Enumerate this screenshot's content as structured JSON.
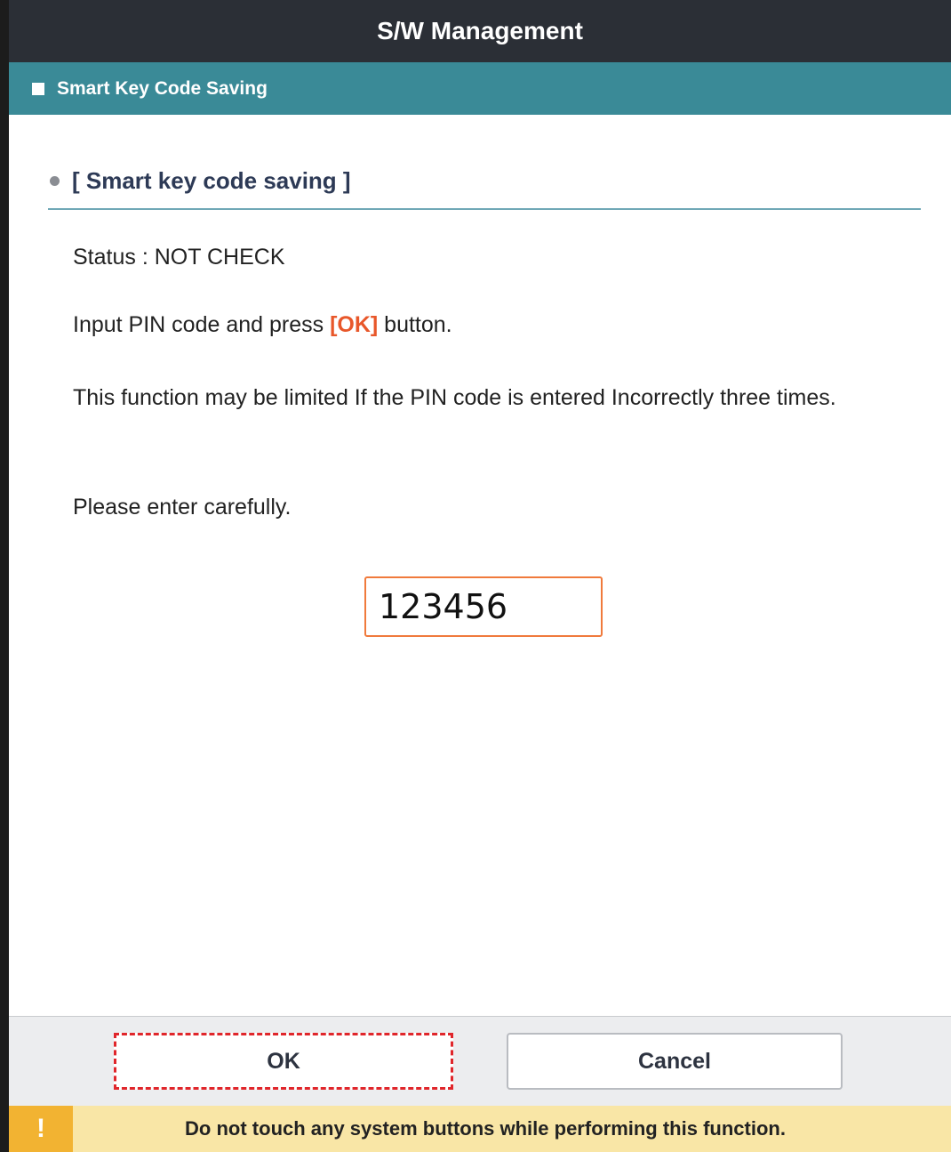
{
  "window": {
    "title": "S/W Management"
  },
  "subheader": {
    "label": "Smart Key Code Saving"
  },
  "section": {
    "title": "[ Smart key code saving ]"
  },
  "content": {
    "status": "Status : NOT CHECK",
    "instruction_prefix": "Input PIN code and press ",
    "instruction_ok": "[OK]",
    "instruction_suffix": " button.",
    "warning_line": "This function may be limited If the PIN code is entered Incorrectly three times.",
    "caution": "Please enter carefully."
  },
  "pin": {
    "value": "123456"
  },
  "buttons": {
    "ok_label": "OK",
    "cancel_label": "Cancel"
  },
  "footer": {
    "icon": "!",
    "message": "Do not touch any system buttons while performing this function."
  },
  "colors": {
    "title_bar": "#2b2f36",
    "sub_bar": "#3a8a97",
    "highlight": "#e8572a",
    "warning_bg": "#f9e6a6",
    "warning_icon_bg": "#f2b332",
    "ok_dashed_outline": "#e0262b"
  }
}
